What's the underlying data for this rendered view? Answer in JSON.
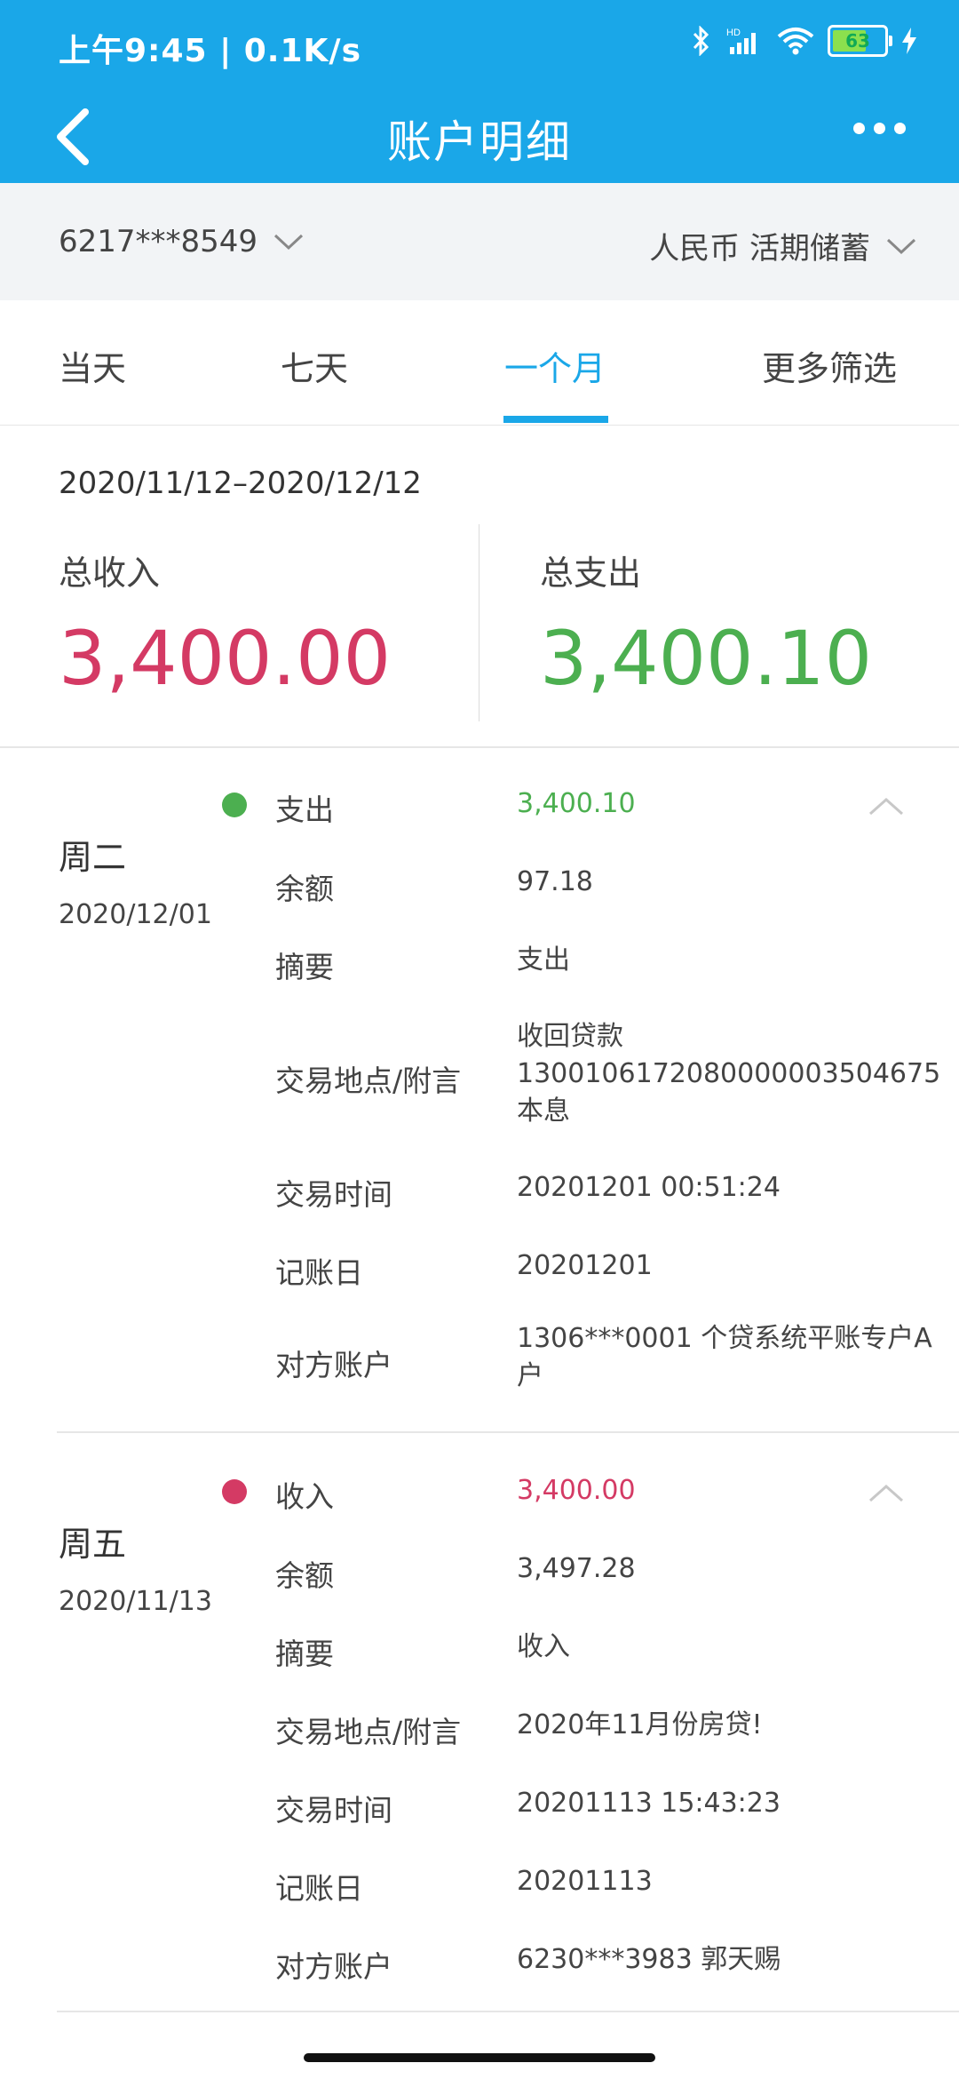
{
  "status": {
    "time": "上午9:45 | 0.1K/s",
    "battery": "63"
  },
  "header": {
    "title": "账户明细"
  },
  "account": {
    "number": "6217***8549",
    "type": "人民币 活期储蓄"
  },
  "tabs": [
    "当天",
    "七天",
    "一个月",
    "更多筛选"
  ],
  "summary": {
    "date_range": "2020/11/12–2020/12/12",
    "income_label": "总收入",
    "income_value": "3,400.00",
    "expense_label": "总支出",
    "expense_value": "3,400.10"
  },
  "colors": {
    "brand": "#1aa7e8",
    "income": "#d43a64",
    "expense": "#4caf50"
  },
  "transactions": [
    {
      "day": "周二",
      "date": "2020/12/01",
      "type_label": "支出",
      "amount": "3,400.10",
      "rows": [
        {
          "label": "余额",
          "value": "97.18"
        },
        {
          "label": "摘要",
          "value": "支出"
        },
        {
          "label": "交易地点/附言",
          "value_lines": [
            "收回贷款",
            "1300106172080000003504675",
            "本息"
          ]
        },
        {
          "label": "交易时间",
          "value": "20201201 00:51:24"
        },
        {
          "label": "记账日",
          "value": "20201201"
        },
        {
          "label": "对方账户",
          "value_lines": [
            "1306***0001 个贷系统平账专户A",
            "户"
          ]
        }
      ]
    },
    {
      "day": "周五",
      "date": "2020/11/13",
      "type_label": "收入",
      "amount": "3,400.00",
      "rows": [
        {
          "label": "余额",
          "value": "3,497.28"
        },
        {
          "label": "摘要",
          "value": "收入"
        },
        {
          "label": "交易地点/附言",
          "value": "2020年11月份房贷!"
        },
        {
          "label": "交易时间",
          "value": "20201113 15:43:23"
        },
        {
          "label": "记账日",
          "value": "20201113"
        },
        {
          "label": "对方账户",
          "value": "6230***3983 郭天赐"
        }
      ]
    }
  ]
}
